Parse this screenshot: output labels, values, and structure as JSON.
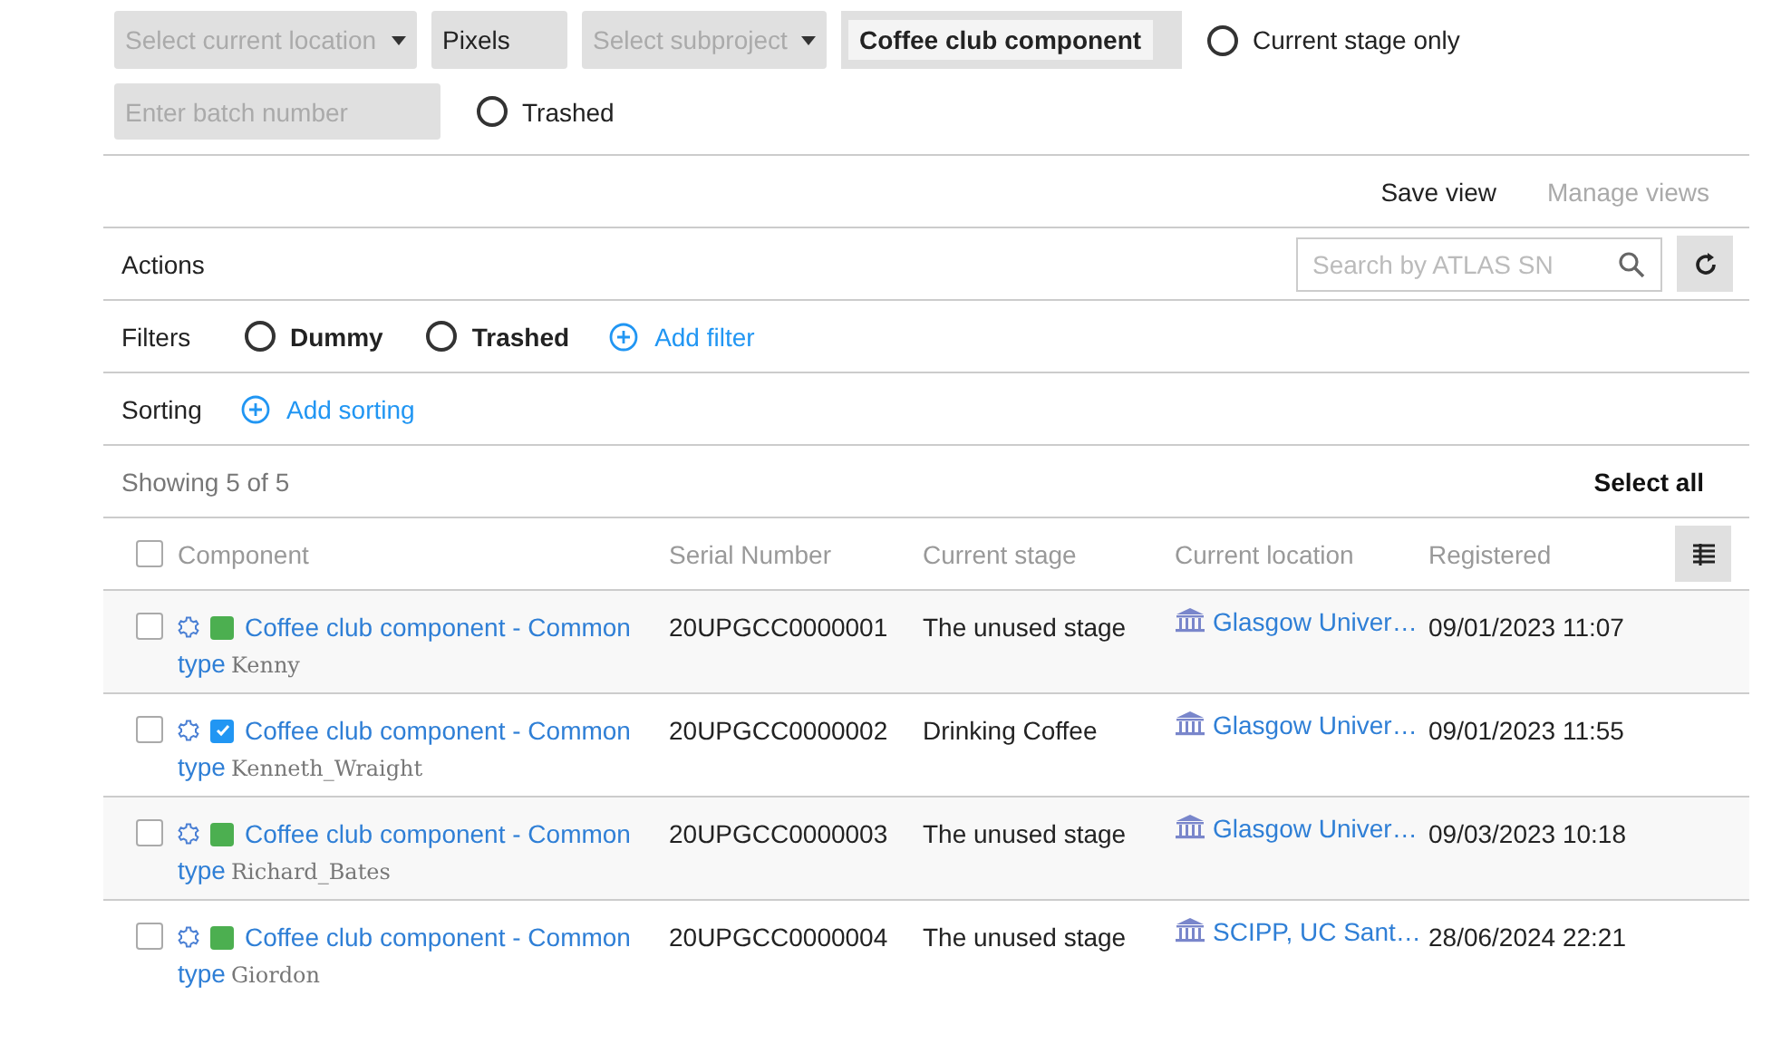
{
  "top_filters": {
    "location": {
      "placeholder": "Select current location"
    },
    "project": {
      "value": "Pixels"
    },
    "subproject": {
      "placeholder": "Select subproject"
    },
    "component_type": {
      "chip": "Coffee club component"
    },
    "current_stage_only": {
      "label": "Current stage only",
      "checked": false
    },
    "batch": {
      "placeholder": "Enter batch number"
    },
    "trashed": {
      "label": "Trashed",
      "checked": false
    }
  },
  "views": {
    "save": "Save view",
    "manage": "Manage views"
  },
  "actions": {
    "label": "Actions",
    "search": {
      "placeholder": "Search by ATLAS SN"
    }
  },
  "filters": {
    "label": "Filters",
    "options": [
      {
        "label": "Dummy",
        "checked": false
      },
      {
        "label": "Trashed",
        "checked": false
      }
    ],
    "add": "Add filter"
  },
  "sorting": {
    "label": "Sorting",
    "add": "Add sorting"
  },
  "summary": {
    "showing": "Showing 5 of 5",
    "select_all": "Select all"
  },
  "table": {
    "columns": [
      "Component",
      "Serial Number",
      "Current stage",
      "Current location",
      "Registered"
    ],
    "all_checked": false,
    "rows": [
      {
        "checked": false,
        "flag_checked": false,
        "component": "Coffee club component - Common",
        "type": "type",
        "owner": "Kenny",
        "serial": "20UPGCC0000001",
        "stage": "The unused stage",
        "location": "Glasgow Univer…",
        "registered": "09/01/2023 11:07"
      },
      {
        "checked": false,
        "flag_checked": true,
        "component": "Coffee club component - Common",
        "type": "type",
        "owner": "Kenneth_Wraight",
        "serial": "20UPGCC0000002",
        "stage": "Drinking Coffee",
        "location": "Glasgow Univer…",
        "registered": "09/01/2023 11:55"
      },
      {
        "checked": false,
        "flag_checked": false,
        "component": "Coffee club component - Common",
        "type": "type",
        "owner": "Richard_Bates",
        "serial": "20UPGCC0000003",
        "stage": "The unused stage",
        "location": "Glasgow Univer…",
        "registered": "09/03/2023 10:18"
      },
      {
        "checked": false,
        "flag_checked": false,
        "component": "Coffee club component - Common",
        "type": "type",
        "owner": "Giordon",
        "serial": "20UPGCC0000004",
        "stage": "The unused stage",
        "location": "SCIPP, UC Sant…",
        "registered": "28/06/2024 22:21"
      }
    ]
  }
}
